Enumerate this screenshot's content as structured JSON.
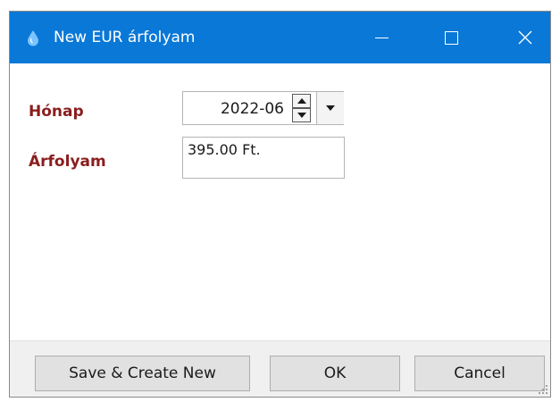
{
  "window": {
    "title": "New EUR árfolyam",
    "accent_color": "#0a78d7",
    "icon": "water-drop-icon"
  },
  "titlebar_buttons": {
    "minimize": "minimize-icon",
    "maximize": "maximize-icon",
    "close": "close-icon"
  },
  "form": {
    "honap_label": "Hónap",
    "honap_value": "2022-06",
    "arfolyam_label": "Árfolyam",
    "arfolyam_value": "395.00 Ft.",
    "label_color": "#8a1d1d"
  },
  "buttons": {
    "save_new": "Save & Create New",
    "ok": "OK",
    "cancel": "Cancel"
  }
}
